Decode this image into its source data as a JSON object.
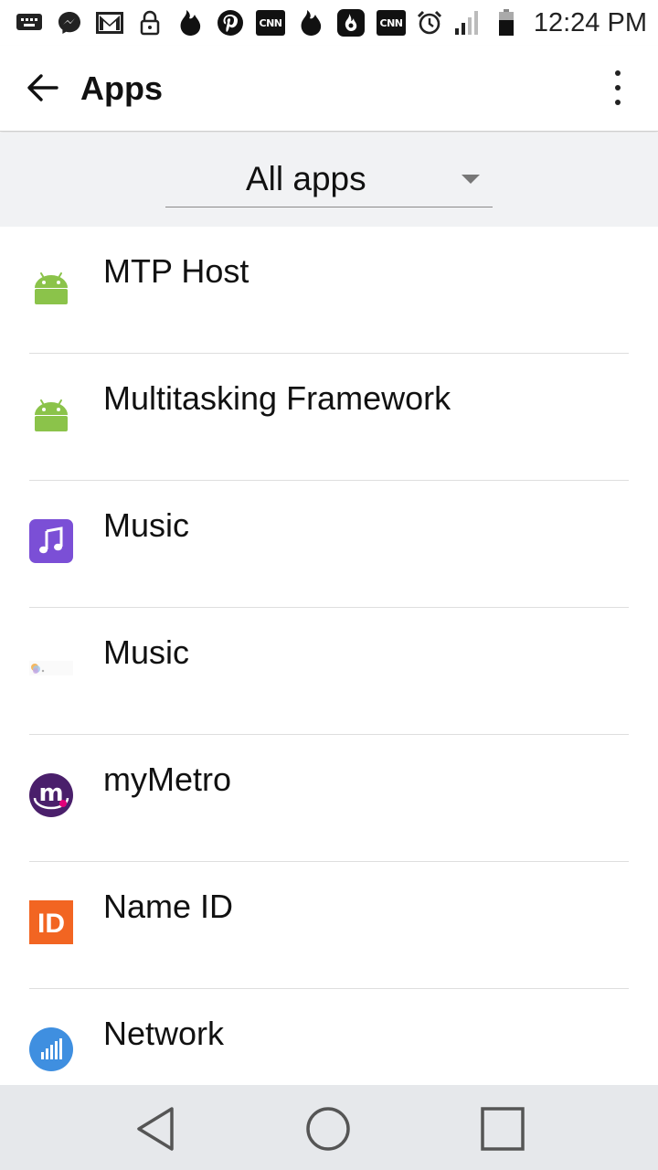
{
  "status_bar": {
    "notification_icons": [
      "keyboard-icon",
      "messenger-icon",
      "gmail-icon",
      "lock-icon",
      "tinder-icon",
      "pinterest-icon",
      "cnn-icon",
      "tinder-icon",
      "hot-flame-app-icon",
      "cnn-icon"
    ],
    "cnn_label": "CNN",
    "time": "12:24 PM"
  },
  "app_bar": {
    "title": "Apps"
  },
  "filter": {
    "selected": "All apps"
  },
  "apps": [
    {
      "name": "MTP Host",
      "icon": "android-robot-icon"
    },
    {
      "name": "Multitasking Framework",
      "icon": "android-robot-icon"
    },
    {
      "name": "Music",
      "icon": "music-note-icon"
    },
    {
      "name": "Music",
      "icon": "music-placeholder-icon"
    },
    {
      "name": "myMetro",
      "icon": "mymetro-icon"
    },
    {
      "name": "Name ID",
      "icon": "name-id-icon"
    },
    {
      "name": "Network",
      "icon": "network-signal-icon"
    }
  ],
  "icon_text": {
    "mymetro": "m",
    "name_id": "ID"
  },
  "colors": {
    "android_green": "#8bc34a",
    "music_purple": "#7b4fd6",
    "mymetro_purple": "#4a1f6b",
    "name_id_orange": "#f26522",
    "network_blue": "#3f8fe0",
    "nav_bar_bg": "#e6e8eb",
    "filter_bg": "#f1f2f4"
  }
}
